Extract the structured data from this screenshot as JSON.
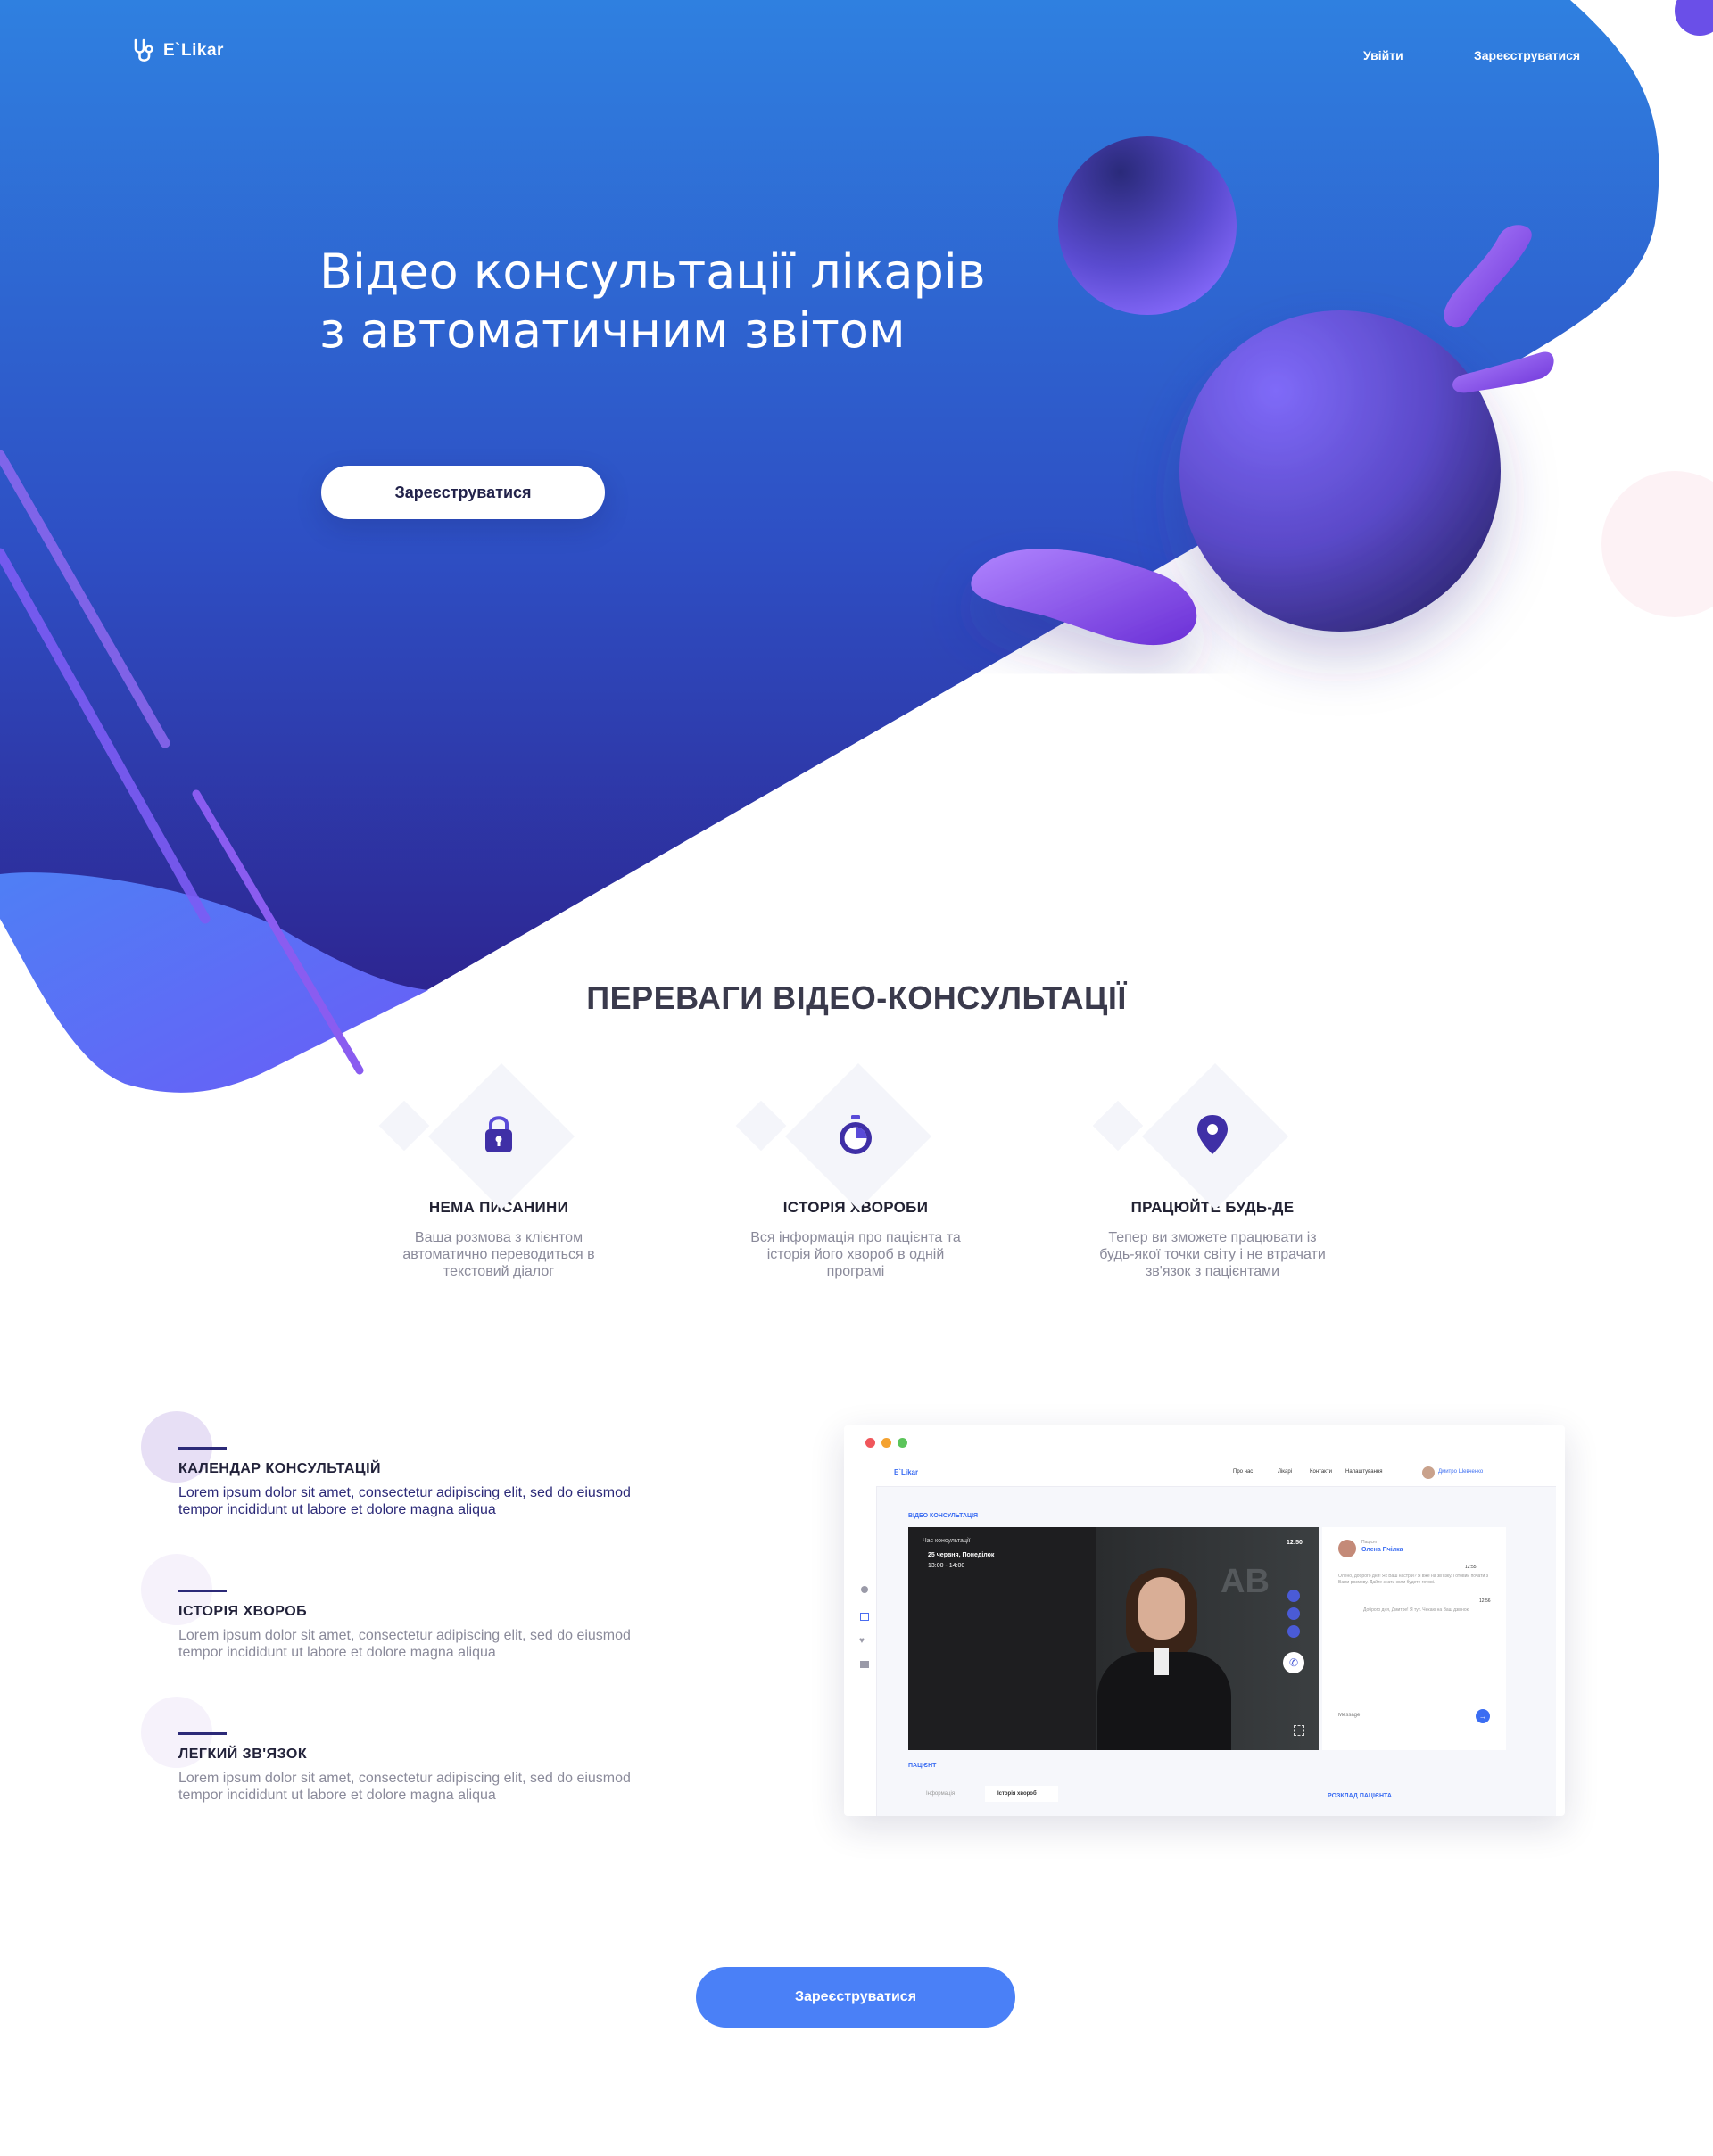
{
  "header": {
    "logo_text": "E`Likar",
    "nav": {
      "login": "Увійти",
      "register": "Зареєструватися"
    }
  },
  "hero": {
    "title_line1": "Відео консультації лікарів",
    "title_line2": "з автоматичним звітом",
    "button": "Зареєструватися"
  },
  "advantages": {
    "title": "ПЕРЕВАГИ ВІДЕО-КОНСУЛЬТАЦІЇ",
    "items": [
      {
        "icon": "lock-icon",
        "title": "НЕМА ПИСАНИНИ",
        "text": "Ваша розмова з клієнтом автоматично переводиться в текстовий діалог"
      },
      {
        "icon": "stopwatch-icon",
        "title": "ІСТОРІЯ ХВОРОБИ",
        "text": "Вся інформація про пацієнта та історія його хвороб в одній програмі"
      },
      {
        "icon": "location-pin-icon",
        "title": "ПРАЦЮЙТЕ БУДЬ-ДЕ",
        "text": "Тепер ви зможете працювати із будь-якої точки світу і не втрачати зв'язок з пацієнтами"
      }
    ]
  },
  "features": [
    {
      "title": "КАЛЕНДАР КОНСУЛЬТАЦІЙ",
      "text": "Lorem ipsum dolor sit amet, consectetur adipiscing elit, sed do eiusmod tempor incididunt ut labore et dolore magna aliqua"
    },
    {
      "title": "ІСТОРІЯ ХВОРОБ",
      "text": "Lorem ipsum dolor sit amet, consectetur adipiscing elit, sed do eiusmod tempor incididunt ut labore et dolore magna aliqua"
    },
    {
      "title": "ЛЕГКИЙ ЗВ'ЯЗОК",
      "text": "Lorem ipsum dolor sit amet, consectetur adipiscing elit, sed do eiusmod tempor incididunt ut labore et dolore magna aliqua"
    }
  ],
  "mockup": {
    "logo": "E`Likar",
    "nav": [
      "Про нас",
      "Лікарі",
      "Контакти",
      "Налаштування"
    ],
    "user": "Дмитро Шевченко",
    "section_label": "ВІДЕО КОНСУЛЬТАЦІЯ",
    "video": {
      "caption": "Час консультації",
      "date": "25 червня, Понеділок",
      "time_range": "13:00 - 14:00",
      "clock": "12:50"
    },
    "chat": {
      "role": "Пацієнт",
      "name": "Олена Пчілка",
      "msg1": "Олено, доброго дня! Як Ваш настрій? Я вже на зв'язку. Готовий почати з Вами розмову. Дайте знати коли будете готові.",
      "t1": "12:55",
      "t2": "12:56",
      "msg2": "Доброго дня, Дмитре! Я тут. Чекаю на Ваш дзвінок",
      "placeholder": "Message"
    },
    "patient_label": "ПАЦІЄНТ",
    "tabs": [
      "Інформація",
      "Історія хвороб"
    ],
    "schedule_label": "РОЗКЛАД ПАЦІЄНТА"
  },
  "cta": {
    "button": "Зареєструватися"
  },
  "colors": {
    "hero_top": "#2f7ee0",
    "hero_bottom": "#2b2a92",
    "accent_blue": "#4a80f7",
    "purple": "#7a50f0"
  }
}
